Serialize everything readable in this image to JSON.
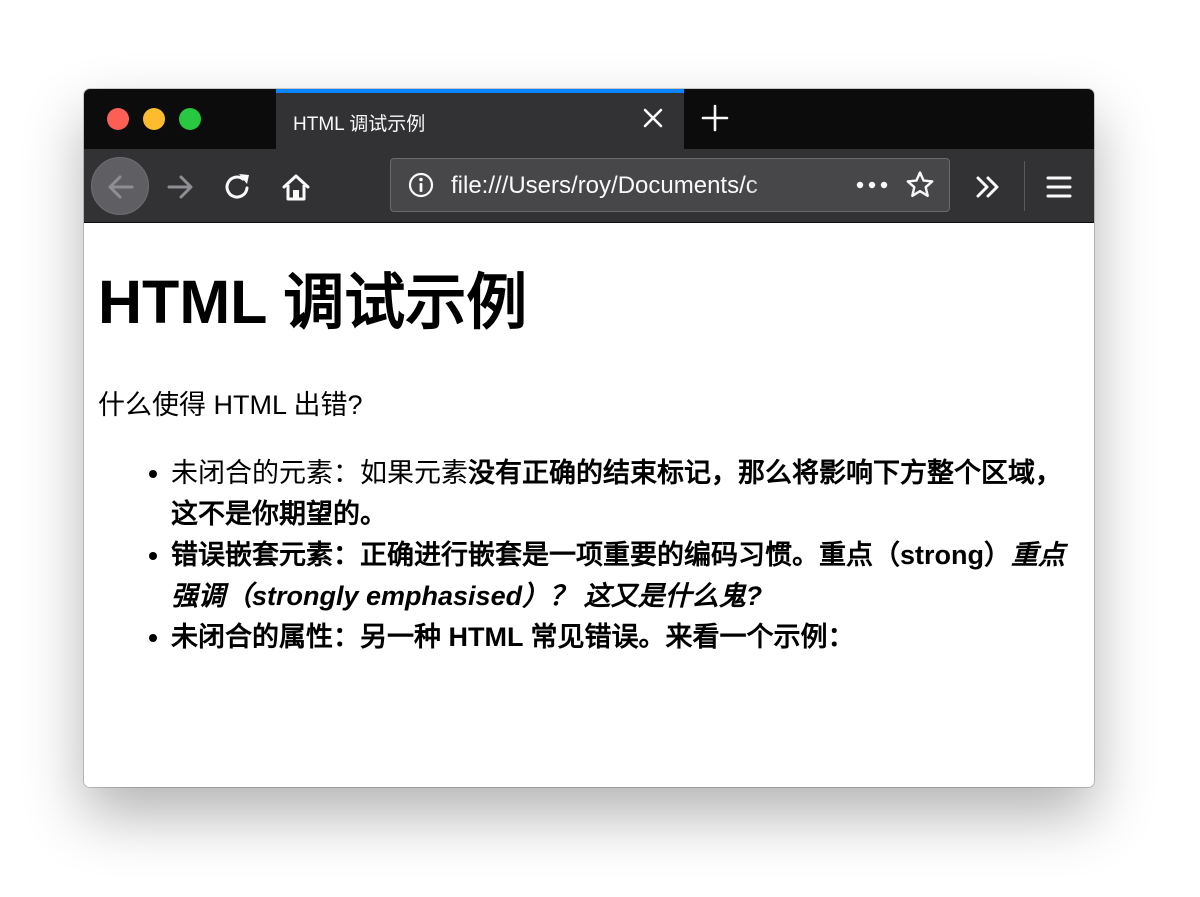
{
  "window": {
    "tab_title": "HTML 调试示例",
    "url": "file:///Users/roy/Documents/c"
  },
  "icons": {
    "close": "close-icon",
    "new_tab": "plus-icon",
    "back": "arrow-left-icon",
    "forward": "arrow-right-icon",
    "reload": "reload-icon",
    "home": "home-icon",
    "info": "info-icon",
    "more": "more-icon",
    "bookmark": "star-icon",
    "overflow": "double-chevron-icon",
    "menu": "hamburger-icon"
  },
  "colors": {
    "tab_accent": "#0a84ff",
    "chrome_dark": "#0c0c0d",
    "chrome_toolbar": "#323234",
    "traffic_close": "#fd5f57",
    "traffic_min": "#fdbc2e",
    "traffic_max": "#28c840"
  },
  "page": {
    "title": "HTML 调试示例",
    "intro": "什么使得 HTML 出错?",
    "items": [
      {
        "plain": "未闭合的元素：如果元素",
        "bold": "没有正确的结束标记，那么将影响下方整个区域，这不是你期望的。"
      },
      {
        "bold": "错误嵌套元素：正确进行嵌套是一项重要的编码习惯。重点（strong）",
        "bold_italic": "重点强调（strongly emphasised）？ 这又是什么鬼?"
      },
      {
        "bold": "未闭合的属性：另一种 HTML 常见错误。来看一个示例："
      }
    ]
  }
}
